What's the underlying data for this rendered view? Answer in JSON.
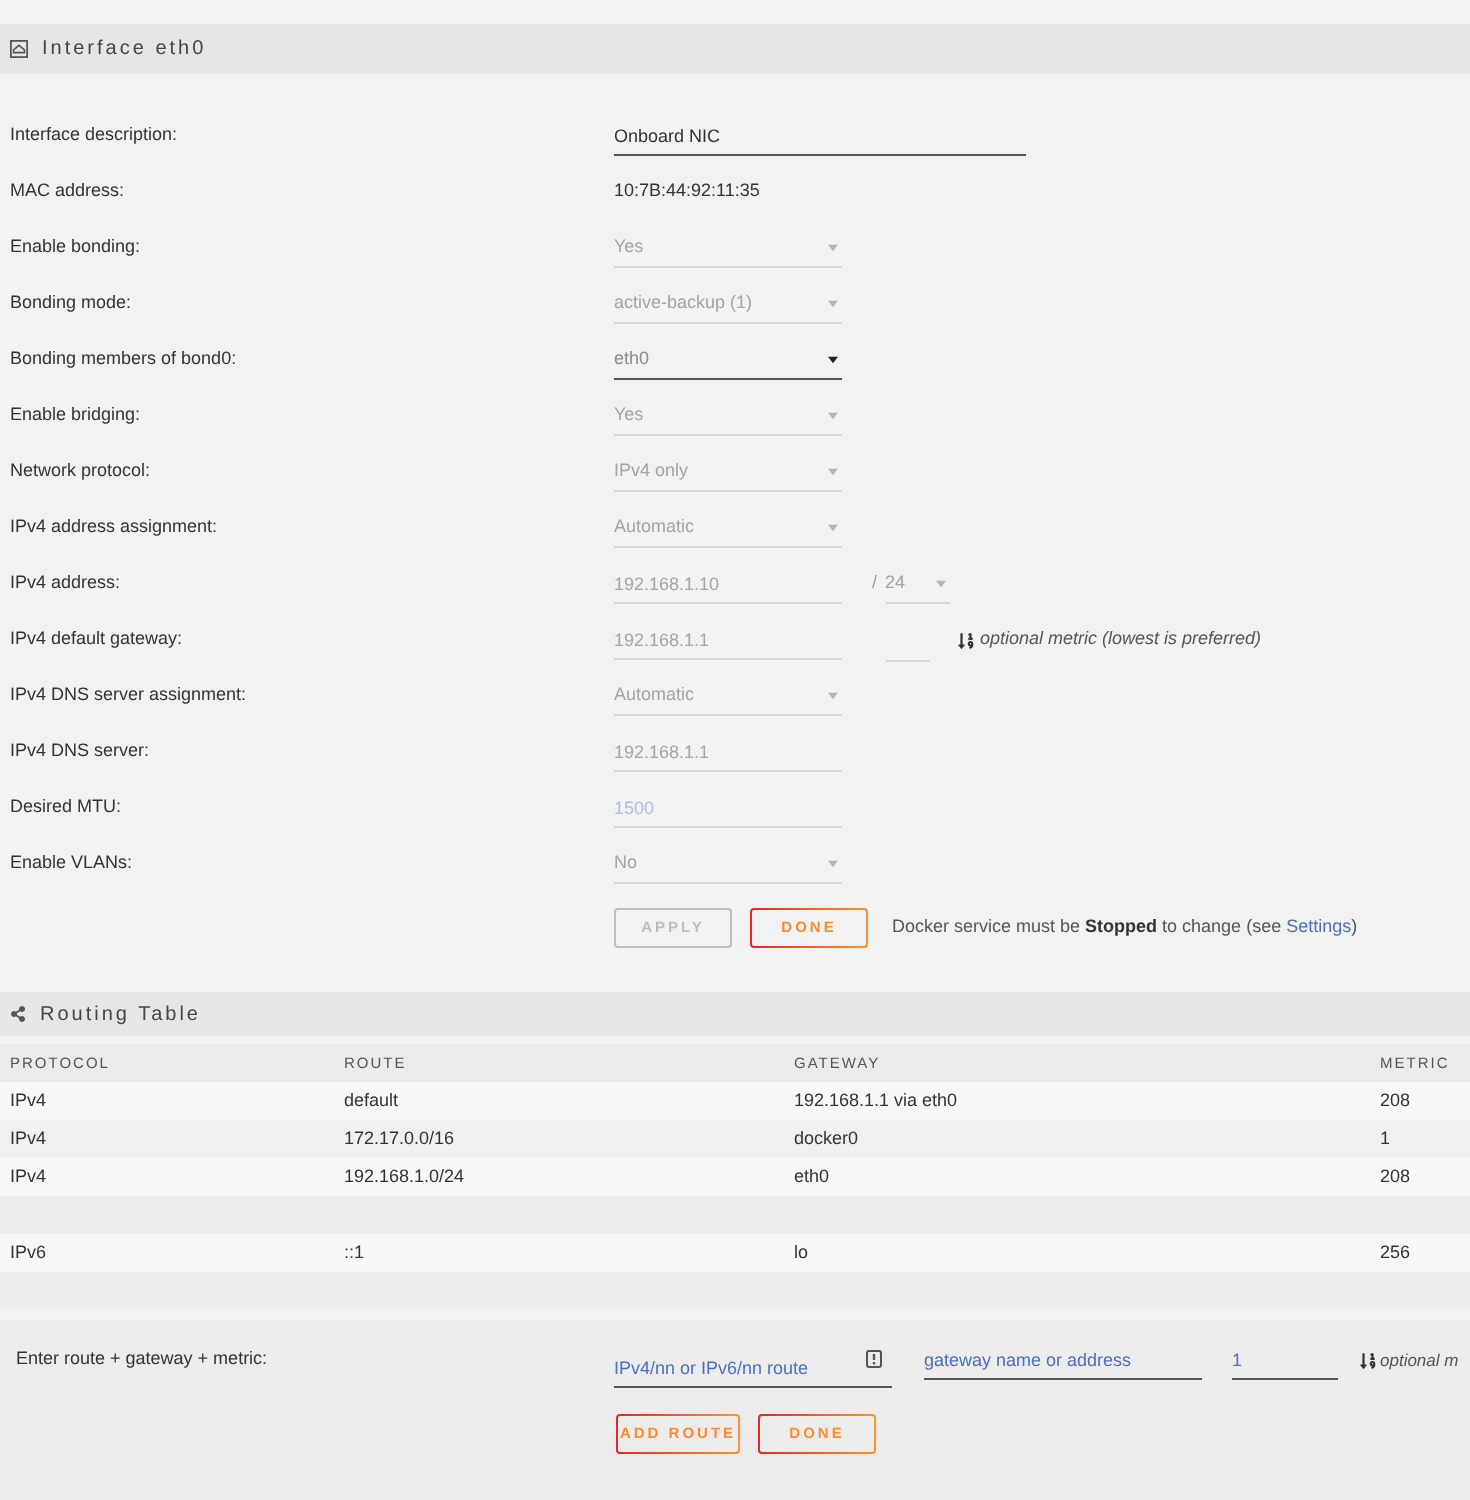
{
  "interface": {
    "title": "Interface eth0",
    "fields": [
      {
        "label": "Interface description:",
        "kind": "text",
        "value": "Onboard NIC",
        "disabled": false
      },
      {
        "label": "MAC address:",
        "kind": "static",
        "value": "10:7B:44:92:11:35"
      },
      {
        "label": "Enable bonding:",
        "kind": "select",
        "value": "Yes",
        "disabled": true
      },
      {
        "label": "Bonding mode:",
        "kind": "select",
        "value": "active-backup (1)",
        "disabled": true
      },
      {
        "label": "Bonding members of bond0:",
        "kind": "select",
        "value": "eth0",
        "disabled": false
      },
      {
        "label": "Enable bridging:",
        "kind": "select",
        "value": "Yes",
        "disabled": true
      },
      {
        "label": "Network protocol:",
        "kind": "select",
        "value": "IPv4 only",
        "disabled": true
      },
      {
        "label": "IPv4 address assignment:",
        "kind": "select",
        "value": "Automatic",
        "disabled": true
      },
      {
        "label": "IPv4 address:",
        "kind": "ip_mask",
        "value": "192.168.1.10",
        "separator": "/",
        "mask": "24",
        "disabled": true
      },
      {
        "label": "IPv4 default gateway:",
        "kind": "ip_metric",
        "value": "192.168.1.1",
        "hint": "optional metric (lowest is preferred)",
        "disabled": true
      },
      {
        "label": "IPv4 DNS server assignment:",
        "kind": "select",
        "value": "Automatic",
        "disabled": true
      },
      {
        "label": "IPv4 DNS server:",
        "kind": "ip",
        "value": "192.168.1.1",
        "disabled": true
      },
      {
        "label": "Desired MTU:",
        "kind": "ip",
        "placeholder": "1500",
        "disabled": true
      },
      {
        "label": "Enable VLANs:",
        "kind": "select",
        "value": "No",
        "disabled": true
      }
    ],
    "buttons": [
      {
        "label": "APPLY",
        "disabled": true
      },
      {
        "label": "DONE",
        "disabled": false
      }
    ],
    "notice": {
      "text": "Docker service must be **Stopped** to change (see ",
      "link": "Settings",
      "text_after": ")"
    }
  },
  "routing": {
    "title": "Routing Table",
    "columns": [
      "PROTOCOL",
      "ROUTE",
      "GATEWAY",
      "METRIC"
    ],
    "groups": [
      {
        "rows": [
          [
            "IPv4",
            "default",
            "192.168.1.1 via eth0",
            "208"
          ],
          [
            "IPv4",
            "172.17.0.0/16",
            "docker0",
            "1"
          ],
          [
            "IPv4",
            "192.168.1.0/24",
            "eth0",
            "208"
          ]
        ]
      },
      {
        "rows": [
          [
            "IPv6",
            "::1",
            "lo",
            "256"
          ]
        ]
      }
    ]
  },
  "add_route": {
    "label": "Enter route + gateway + metric:",
    "route": {
      "placeholder": "IPv4/nn or IPv6/nn route"
    },
    "gateway": {
      "placeholder": "gateway name or address"
    },
    "metric": {
      "value": "1"
    },
    "hint": "optional m",
    "buttons": [
      {
        "label": "ADD ROUTE",
        "disabled": false
      },
      {
        "label": "DONE",
        "disabled": false
      }
    ]
  }
}
